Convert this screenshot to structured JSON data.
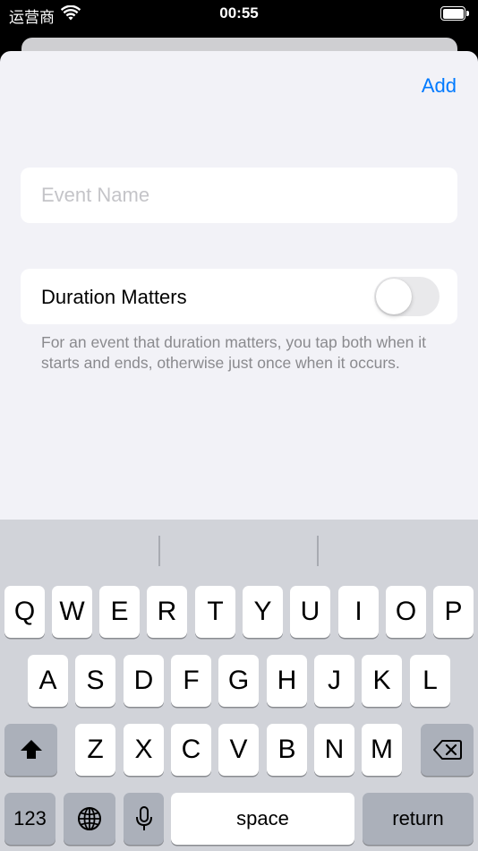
{
  "status_bar": {
    "carrier": "运营商",
    "time": "00:55"
  },
  "header": {
    "add_label": "Add"
  },
  "form": {
    "event_name_placeholder": "Event Name",
    "event_name_value": "",
    "duration_label": "Duration Matters",
    "duration_on": false,
    "footer": "For an event that duration matters, you tap both when it starts and ends, otherwise just once when it occurs."
  },
  "keyboard": {
    "row1": [
      "Q",
      "W",
      "E",
      "R",
      "T",
      "Y",
      "U",
      "I",
      "O",
      "P"
    ],
    "row2": [
      "A",
      "S",
      "D",
      "F",
      "G",
      "H",
      "J",
      "K",
      "L"
    ],
    "row3": [
      "Z",
      "X",
      "C",
      "V",
      "B",
      "N",
      "M"
    ],
    "numbers_label": "123",
    "space_label": "space",
    "return_label": "return"
  }
}
